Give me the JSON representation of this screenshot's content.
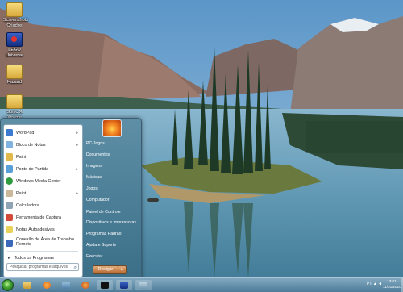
{
  "desktop": {
    "icons": [
      {
        "label": "Screenshots Criados",
        "icon": "folder-icon"
      },
      {
        "label": "LEGO Universe",
        "icon": "lego-icon"
      },
      {
        "label": "Hazard",
        "icon": "folder-icon"
      },
      {
        "label": "Sonic X Xtreme",
        "icon": "folder-icon"
      }
    ]
  },
  "start_menu": {
    "programs": [
      {
        "label": "WordPad",
        "has_submenu": true
      },
      {
        "label": "Bloco de Notas",
        "has_submenu": true
      },
      {
        "label": "Paint",
        "has_submenu": false
      },
      {
        "label": "Ponto de Partida",
        "has_submenu": true
      },
      {
        "label": "Windows Media Center",
        "has_submenu": false
      },
      {
        "label": "Paint",
        "has_submenu": true
      },
      {
        "label": "Calculadora",
        "has_submenu": false
      },
      {
        "label": "Ferramenta de Captura",
        "has_submenu": false
      },
      {
        "label": "Notas Autoadesivas",
        "has_submenu": false
      },
      {
        "label": "Conexão de Área de Trabalho Remota",
        "has_submenu": false
      }
    ],
    "all_programs": "Todos os Programas",
    "search_placeholder": "Pesquisar programas e arquivos",
    "right_items": [
      {
        "label": "PC-Jogos",
        "has_submenu": false
      },
      {
        "label": "Documentos",
        "has_submenu": false
      },
      {
        "label": "Imagens",
        "has_submenu": false
      },
      {
        "label": "Músicas",
        "has_submenu": false
      },
      {
        "label": "Jogos",
        "has_submenu": false
      },
      {
        "label": "Computador",
        "has_submenu": false
      },
      {
        "label": "Painel de Controle",
        "has_submenu": false
      },
      {
        "label": "Dispositivos e Impressoras",
        "has_submenu": false
      },
      {
        "label": "Programas Padrão",
        "has_submenu": false
      },
      {
        "label": "Ajuda e Suporte",
        "has_submenu": false
      },
      {
        "label": "Executar...",
        "has_submenu": false
      }
    ],
    "shutdown_label": "Desligar",
    "shutdown_arrow": "▸"
  },
  "taskbar": {
    "tray_text": "PT ▲ ◄",
    "clock_time": "13:01",
    "clock_date": "11/01/2010"
  },
  "colors": {
    "taskbar": "#4c7b98",
    "start_menu": "#3b6f88",
    "accent": "#2a5b8a"
  }
}
